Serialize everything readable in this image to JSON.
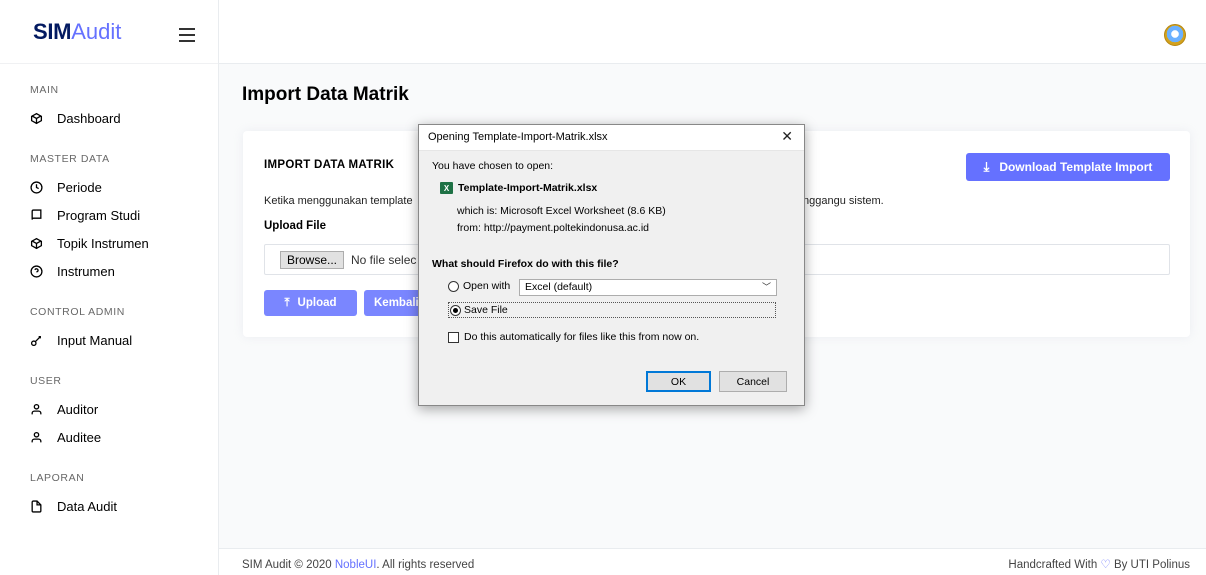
{
  "brand": {
    "strong": "SIM",
    "light": "Audit"
  },
  "sidebar": {
    "sections": [
      {
        "category": "MAIN",
        "items": [
          {
            "label": "Dashboard",
            "icon": "box-icon"
          }
        ]
      },
      {
        "category": "MASTER DATA",
        "items": [
          {
            "label": "Periode",
            "icon": "clock-icon"
          },
          {
            "label": "Program Studi",
            "icon": "book-icon"
          },
          {
            "label": "Topik Instrumen",
            "icon": "box-icon"
          },
          {
            "label": "Instrumen",
            "icon": "help-circle-icon"
          }
        ]
      },
      {
        "category": "CONTROL ADMIN",
        "items": [
          {
            "label": "Input Manual",
            "icon": "key-icon"
          }
        ]
      },
      {
        "category": "USER",
        "items": [
          {
            "label": "Auditor",
            "icon": "user-icon"
          },
          {
            "label": "Auditee",
            "icon": "user-icon"
          }
        ]
      },
      {
        "category": "LAPORAN",
        "items": [
          {
            "label": "Data Audit",
            "icon": "file-icon"
          }
        ]
      }
    ]
  },
  "page": {
    "title": "Import Data Matrik",
    "card_title": "IMPORT DATA MATRIK",
    "download_label": "Download Template Import",
    "note_left": "Ketika menggunakan template",
    "note_right": "nggangu sistem.",
    "upload_label": "Upload File",
    "browse_label": "Browse...",
    "no_file": "No file selec",
    "upload_button": "Upload",
    "back_button": "Kembali"
  },
  "footer": {
    "left_prefix": "SIM Audit © 2020 ",
    "left_link": "NobleUI",
    "left_suffix": ". All rights reserved",
    "right_prefix": "Handcrafted With ",
    "right_suffix": " By UTI Polinus"
  },
  "dialog": {
    "title": "Opening Template-Import-Matrik.xlsx",
    "chosen_label": "You have chosen to open:",
    "file_name": "Template-Import-Matrik.xlsx",
    "which_is": "which is:  Microsoft Excel Worksheet (8.6 KB)",
    "from": "from:  http://payment.poltekindonusa.ac.id",
    "question": "What should Firefox do with this file?",
    "open_with_label": "Open with",
    "open_with_value": "Excel (default)",
    "save_label": "Save File",
    "auto_label": "Do this automatically for files like this from now on.",
    "ok": "OK",
    "cancel": "Cancel",
    "selected_option": "save"
  },
  "colors": {
    "accent": "#6571ff",
    "brand_dark": "#031a61"
  }
}
